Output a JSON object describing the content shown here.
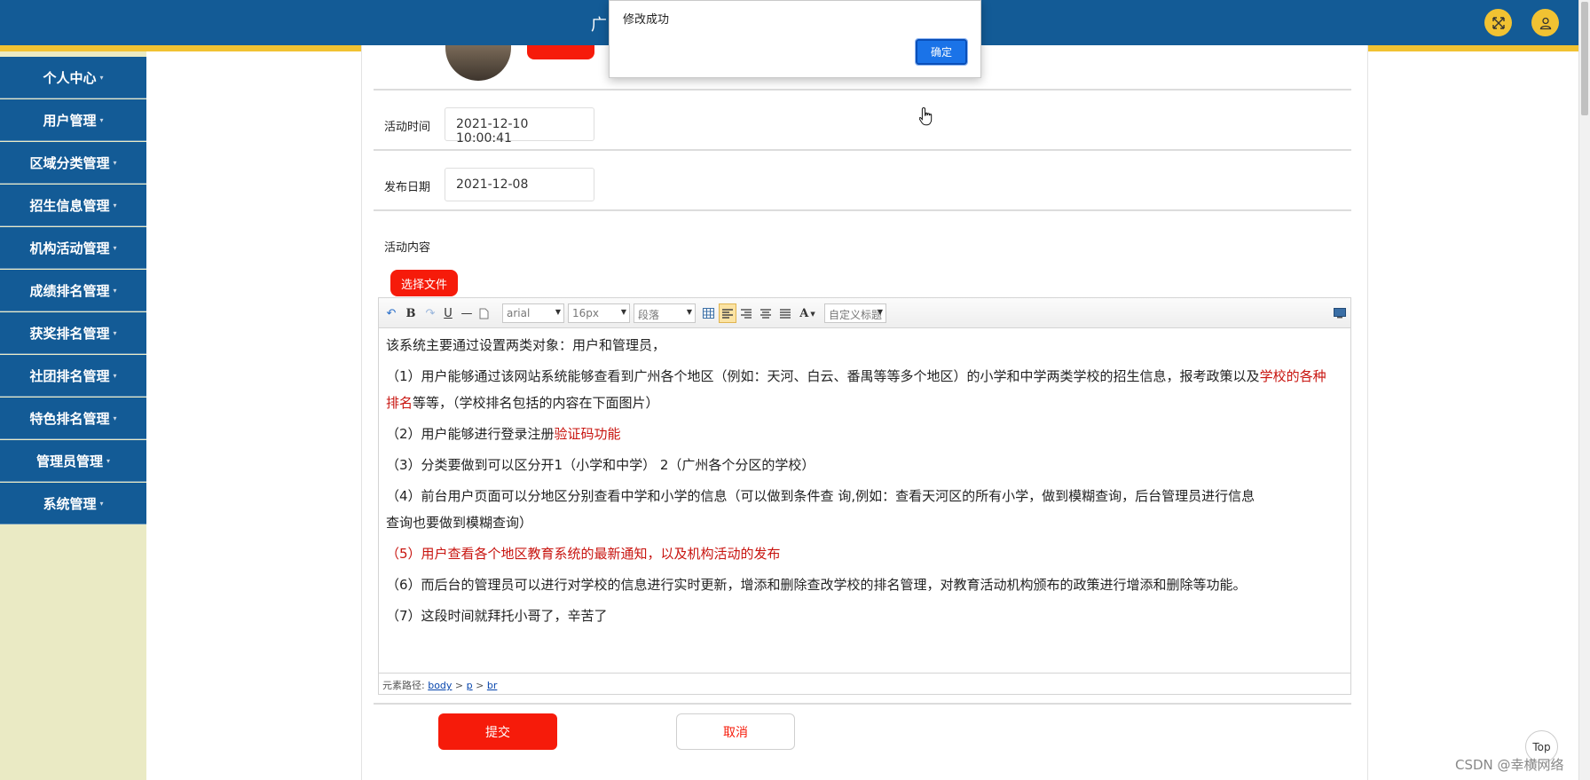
{
  "header": {
    "title_visible": "广",
    "icons": [
      "fullscreen-icon",
      "user-icon"
    ],
    "bar_color": "#135b96",
    "accent_color": "#f1c232"
  },
  "sidebar": {
    "items": [
      {
        "label": "个人中心"
      },
      {
        "label": "用户管理"
      },
      {
        "label": "区域分类管理"
      },
      {
        "label": "招生信息管理"
      },
      {
        "label": "机构活动管理"
      },
      {
        "label": "成绩排名管理"
      },
      {
        "label": "获奖排名管理"
      },
      {
        "label": "社团排名管理"
      },
      {
        "label": "特色排名管理"
      },
      {
        "label": "管理员管理"
      },
      {
        "label": "系统管理"
      }
    ]
  },
  "form": {
    "activity_time_label": "活动时间",
    "activity_time_value": "2021-12-10 10:00:41",
    "publish_date_label": "发布日期",
    "publish_date_value": "2021-12-08",
    "content_label": "活动内容",
    "file_button": "选择文件",
    "submit_label": "提交",
    "cancel_label": "取消"
  },
  "editor": {
    "toolbar": {
      "font_family": "arial",
      "font_size": "16px",
      "paragraph": "段落",
      "custom_title": "自定义标题"
    },
    "paragraphs": [
      {
        "parts": [
          {
            "text": "  该系统主要通过设置两类对象：用户和管理员，"
          }
        ]
      },
      {
        "parts": [
          {
            "text": "  （1）用户能够通过该网站系统能够查看到广州各个地区（例如：天河、白云、番禺等等多个地区）的小学和中学两类学校的招生信息，报考政策以及"
          },
          {
            "text": "学校的各种",
            "red": true
          }
        ]
      },
      {
        "parts": [
          {
            "text": "排名",
            "red": true
          },
          {
            "text": "等等，（学校排名包括的内容在下面图片）"
          }
        ]
      },
      {
        "parts": [
          {
            "text": "  （2）用户能够进行登录注册"
          },
          {
            "text": "验证码功能",
            "red": true
          }
        ]
      },
      {
        "parts": [
          {
            "text": "  （3）分类要做到可以区分开1（小学和中学） 2（广州各个分区的学校）"
          }
        ]
      },
      {
        "parts": [
          {
            "text": "  （4）前台用户页面可以分地区分别查看中学和小学的信息（可以做到条件查          询,例如：查看天河区的所有小学，做到模糊查询，后台管理员进行信息"
          }
        ]
      },
      {
        "parts": [
          {
            "text": "查询也要做到模糊查询）"
          }
        ]
      },
      {
        "parts": [
          {
            "text": "  （5）用户查看各个地区教育系统的最新通知，以及机构活动的发布",
            "red": true
          }
        ]
      },
      {
        "parts": [
          {
            "text": "  （6）而后台的管理员可以进行对学校的信息进行实时更新，增添和删除查改学校的排名管理，对教育活动机构颁布的政策进行增添和删除等功能。"
          }
        ]
      },
      {
        "parts": [
          {
            "text": "  （7）这段时间就拜托小哥了，辛苦了"
          }
        ]
      }
    ],
    "status_prefix": "元素路径:",
    "path": [
      "body",
      "p",
      "br"
    ]
  },
  "alert": {
    "message": "修改成功",
    "ok_label": "确定"
  },
  "top_button": "Top",
  "watermark": "CSDN @幸横网络"
}
